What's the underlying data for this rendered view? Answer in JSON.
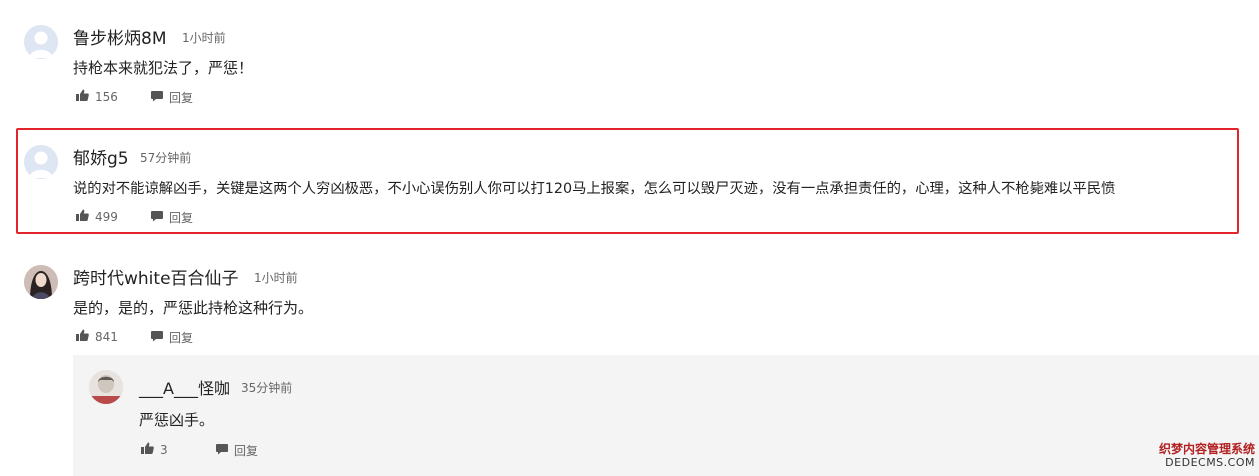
{
  "comments": [
    {
      "user": "鲁步彬炳8M",
      "time": "1小时前",
      "text": "持枪本来就犯法了，严惩！",
      "likes": "156",
      "reply_label": "回复"
    },
    {
      "user": "郁娇g5",
      "time": "57分钟前",
      "text": "说的对不能谅解凶手，关键是这两个人穷凶极恶，不小心误伤别人你可以打120马上报案，怎么可以毁尸灭迹，没有一点承担责任的，心理，这种人不枪毙难以平民愤",
      "likes": "499",
      "reply_label": "回复"
    },
    {
      "user": "跨时代white百合仙子",
      "time": "1小时前",
      "text": "是的，是的，严惩此持枪这种行为。",
      "likes": "841",
      "reply_label": "回复"
    }
  ],
  "reply": {
    "user": "___A___怪咖",
    "time": "35分钟前",
    "text": "严惩凶手。",
    "likes": "3",
    "reply_label": "回复"
  },
  "watermark": {
    "line1": "织梦内容管理系统",
    "line2": "DEDECMS.COM"
  },
  "colors": {
    "highlight_border": "#e3242b",
    "reply_bg": "#f4f4f4",
    "default_avatar": "#dfe6f3"
  }
}
